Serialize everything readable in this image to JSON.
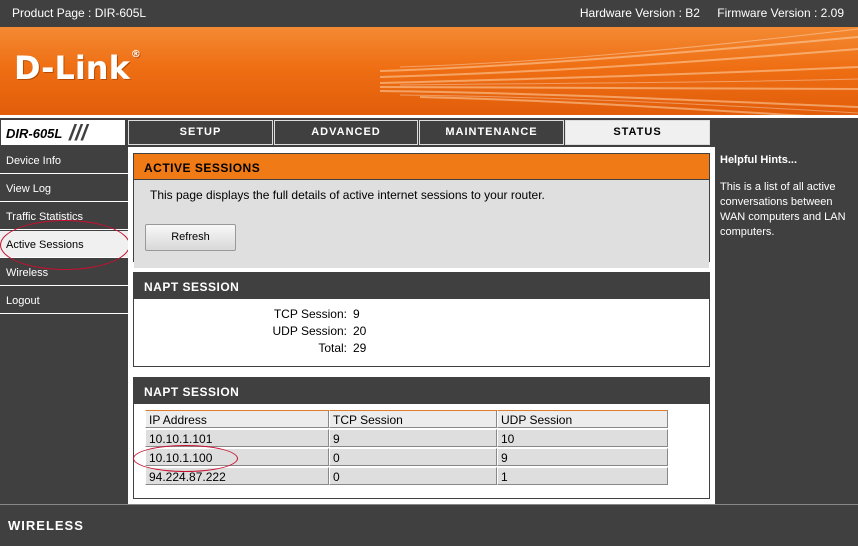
{
  "topbar": {
    "product": "Product Page : DIR-605L",
    "hardware": "Hardware Version : B2",
    "firmware": "Firmware Version : 2.09"
  },
  "brand": {
    "logo": "D-Link",
    "reg": "®",
    "model": "DIR-605L"
  },
  "tabs": [
    {
      "label": "SETUP"
    },
    {
      "label": "ADVANCED"
    },
    {
      "label": "MAINTENANCE"
    },
    {
      "label": "STATUS"
    }
  ],
  "active_tab": "STATUS",
  "sidebar": {
    "items": [
      {
        "label": "Device Info"
      },
      {
        "label": "View Log"
      },
      {
        "label": "Traffic Statistics"
      },
      {
        "label": "Active Sessions"
      },
      {
        "label": "Wireless"
      },
      {
        "label": "Logout"
      }
    ],
    "active": "Active Sessions"
  },
  "active_sessions": {
    "title": "ACTIVE SESSIONS",
    "description": "This page displays the full details of active internet sessions to your router.",
    "refresh_label": "Refresh"
  },
  "napt_summary": {
    "title": "NAPT SESSION",
    "rows": [
      {
        "label": "TCP Session:",
        "value": "9"
      },
      {
        "label": "UDP Session:",
        "value": "20"
      },
      {
        "label": "Total:",
        "value": "29"
      }
    ]
  },
  "napt_table": {
    "title": "NAPT SESSION",
    "columns": [
      "IP Address",
      "TCP Session",
      "UDP Session"
    ],
    "rows": [
      [
        "10.10.1.101",
        "9",
        "10"
      ],
      [
        "10.10.1.100",
        "0",
        "9"
      ],
      [
        "94.224.87.222",
        "0",
        "1"
      ]
    ]
  },
  "hints": {
    "title": "Helpful Hints...",
    "body": "This is a list of all active conversations between WAN computers and LAN computers."
  },
  "footer": {
    "label": "WIRELESS"
  },
  "colors": {
    "accent": "#f07a16",
    "dark": "#404040",
    "annotation": "#c8102e"
  }
}
